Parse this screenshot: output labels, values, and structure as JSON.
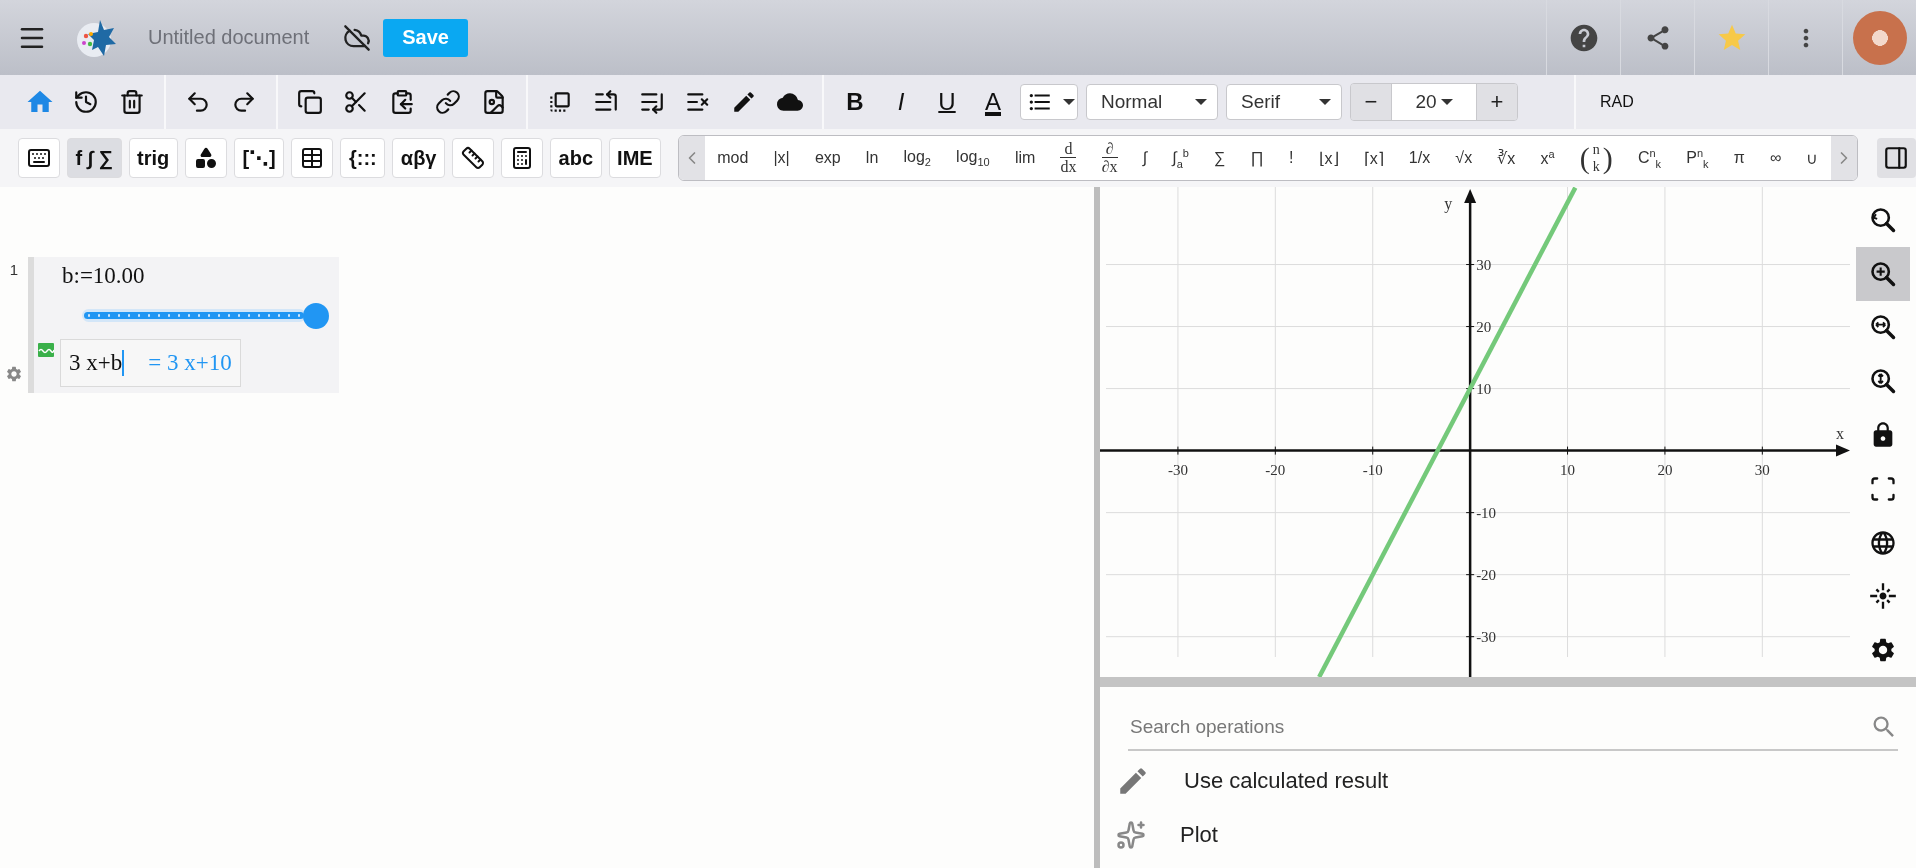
{
  "topbar": {
    "title": "Untitled document",
    "save_label": "Save"
  },
  "toolbar": {
    "format_buttons": [
      "B",
      "I",
      "U",
      "A"
    ],
    "paragraph_style": "Normal",
    "font_family": "Serif",
    "size_decrease": "−",
    "font_size": "20",
    "size_increase": "+",
    "angle_mode": "RAD"
  },
  "palette_tabs": [
    {
      "kind": "icon",
      "selected": false
    },
    {
      "kind": "text",
      "label": "f ∫ ∑",
      "selected": true
    },
    {
      "kind": "text",
      "label": "trig",
      "selected": false
    },
    {
      "kind": "icon",
      "selected": false
    },
    {
      "kind": "text",
      "label": "[⋱]",
      "selected": false
    },
    {
      "kind": "icon",
      "selected": false
    },
    {
      "kind": "text",
      "label": "{:::",
      "selected": false
    },
    {
      "kind": "text",
      "label": "αβγ",
      "selected": false
    },
    {
      "kind": "icon",
      "selected": false
    },
    {
      "kind": "icon",
      "selected": false
    },
    {
      "kind": "text",
      "label": "abc",
      "selected": false
    },
    {
      "kind": "text",
      "label": "IME",
      "selected": false
    }
  ],
  "palette_items": [
    {
      "kind": "text",
      "label": "mod"
    },
    {
      "kind": "text",
      "label": "|x|"
    },
    {
      "kind": "text",
      "label": "exp"
    },
    {
      "kind": "text",
      "label": "ln"
    },
    {
      "kind": "text",
      "label": "log$_{2}$"
    },
    {
      "kind": "text",
      "label": "log$_{10}$"
    },
    {
      "kind": "text",
      "label": "lim"
    },
    {
      "kind": "frac",
      "top": "d",
      "bottom": "dx"
    },
    {
      "kind": "frac",
      "top": "∂",
      "bottom": "∂x"
    },
    {
      "kind": "text",
      "label": "∫"
    },
    {
      "kind": "text",
      "label": "∫$_{a}$$^{b}$"
    },
    {
      "kind": "text",
      "label": "∑"
    },
    {
      "kind": "text",
      "label": "∏"
    },
    {
      "kind": "text",
      "label": "!"
    },
    {
      "kind": "text",
      "label": "⌊x⌋"
    },
    {
      "kind": "text",
      "label": "⌈x⌉"
    },
    {
      "kind": "text",
      "label": "1/x"
    },
    {
      "kind": "text",
      "label": "√x"
    },
    {
      "kind": "text",
      "label": "∛x"
    },
    {
      "kind": "text",
      "label": "x$^{a}$"
    },
    {
      "kind": "binom",
      "left": "(",
      "top": "n",
      "bottom": "k",
      "right": ")"
    },
    {
      "kind": "text",
      "label": "C$^{n}$$_{k}$"
    },
    {
      "kind": "text",
      "label": "P$^{n}$$_{k}$"
    },
    {
      "kind": "text",
      "label": "π"
    },
    {
      "kind": "text",
      "label": "∞"
    },
    {
      "kind": "text",
      "label": "∪"
    }
  ],
  "worksheet": {
    "regions": [
      {
        "number": "1",
        "definition": "b:=10.00",
        "slider": {
          "level": 1.0
        },
        "expression": "3 x+b",
        "result": "= 3 x+10"
      }
    ]
  },
  "graph": {
    "tools": [
      {
        "selected": false
      },
      {
        "selected": true
      },
      {
        "selected": false
      },
      {
        "selected": false
      },
      {
        "selected": false
      },
      {
        "selected": false
      },
      {
        "selected": false
      },
      {
        "selected": false
      },
      {
        "selected": false
      }
    ],
    "chart_data": {
      "type": "line",
      "xlabel": "x",
      "ylabel": "y",
      "x": [
        -15.5,
        10.8
      ],
      "series": [
        {
          "color": "#74c97a",
          "values": [
            -36.5,
            42.4
          ]
        }
      ],
      "xlim": [
        -38,
        39
      ],
      "ylim": [
        -36.5,
        42.5
      ],
      "grid": true,
      "xticks": [
        -30,
        -20,
        -10,
        10,
        20,
        30
      ],
      "yticks": [
        -30,
        -20,
        -10,
        10,
        20,
        30
      ]
    }
  },
  "operations": {
    "search": {
      "placeholder": "Search operations"
    },
    "items": [
      {
        "kind": "use-result",
        "label": "Use calculated result"
      },
      {
        "kind": "plot",
        "label": "Plot"
      }
    ]
  }
}
